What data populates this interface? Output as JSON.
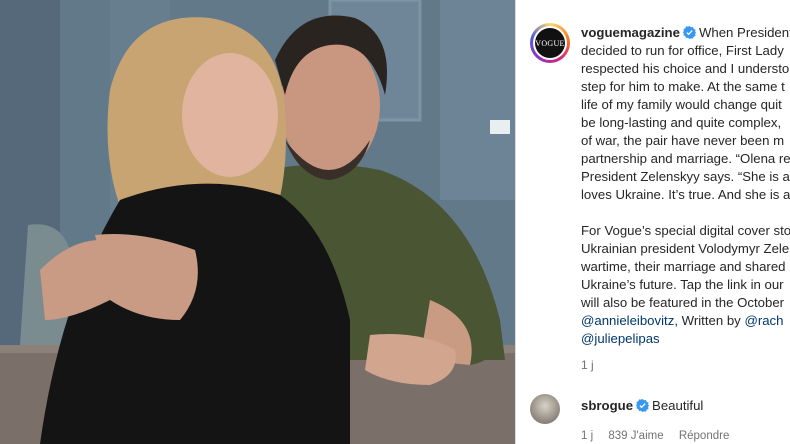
{
  "post": {
    "username": "voguemagazine",
    "avatar_logo_text": "VOGUE",
    "caption_lines": [
      "When President",
      "decided to run for office, First Lady",
      "respected his choice and I understo",
      "step for him to make. At the same t",
      "life of my family would change quit",
      "be long-lasting and quite complex,",
      "of war, the pair have never been m",
      "partnership and marriage. “Olena re",
      "President Zelenskyy says. “She is als",
      "loves Ukraine. It’s true. And she is a",
      "For Vogue’s special digital cover sto",
      "Ukrainian president Volodymyr Zele",
      "wartime, their marriage and shared",
      "Ukraine’s future. Tap the link in our",
      "will also be featured in the October"
    ],
    "mention_line": {
      "mention1": "@annieleibovitz",
      "middle": ", Written by ",
      "mention2": "@rach"
    },
    "mention_last": "@juliepelipas",
    "time": "1 j"
  },
  "comment": {
    "username": "sbrogue",
    "text": "Beautiful",
    "time": "1 j",
    "likes": "839 J'aime",
    "reply": "Répondre"
  },
  "colors": {
    "verified": "#3897f0",
    "mention": "#00376b",
    "text": "#262626",
    "muted": "#737373"
  }
}
